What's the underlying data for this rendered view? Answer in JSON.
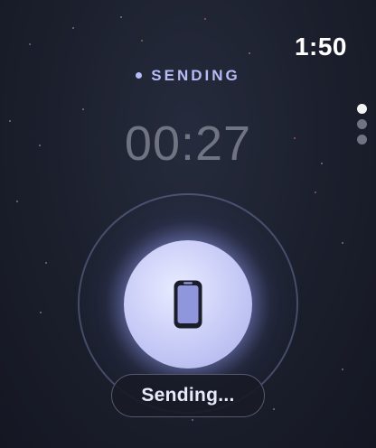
{
  "status_bar": {
    "time": "1:50"
  },
  "transfer": {
    "status_label": "SENDING",
    "elapsed": "00:27",
    "button_icon": "phone-icon",
    "pill_label": "Sending..."
  },
  "page_indicator": {
    "count": 3,
    "active_index": 0
  },
  "colors": {
    "accent": "#b6bcf6",
    "timer": "#6f7382",
    "background": "#1b1f2c",
    "button": "#c9cdf7"
  }
}
